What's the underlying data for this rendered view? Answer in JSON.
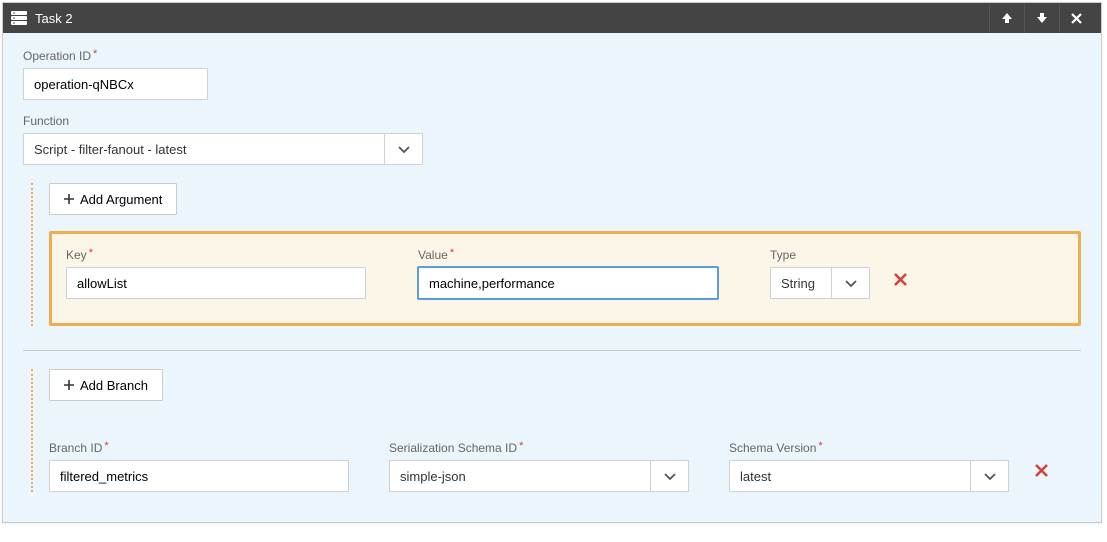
{
  "header": {
    "title": "Task 2"
  },
  "operation": {
    "label": "Operation ID",
    "value": "operation-qNBCx"
  },
  "function": {
    "label": "Function",
    "value": "Script - filter-fanout - latest"
  },
  "arguments": {
    "addLabel": "Add Argument",
    "entry": {
      "keyLabel": "Key",
      "keyValue": "allowList",
      "valueLabel": "Value",
      "valueValue": "machine,performance",
      "typeLabel": "Type",
      "typeValue": "String"
    }
  },
  "branches": {
    "addLabel": "Add Branch",
    "entry": {
      "branchIdLabel": "Branch ID",
      "branchIdValue": "filtered_metrics",
      "schemaIdLabel": "Serialization Schema ID",
      "schemaIdValue": "simple-json",
      "schemaVersionLabel": "Schema Version",
      "schemaVersionValue": "latest"
    }
  }
}
